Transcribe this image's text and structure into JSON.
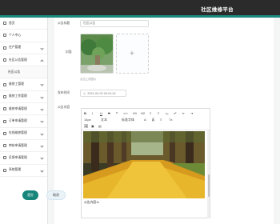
{
  "app": {
    "title": "社区维修平台"
  },
  "sidebar": {
    "items": [
      {
        "label": "首页",
        "icon": "home-icon"
      },
      {
        "label": "个人中心",
        "icon": "user-icon"
      },
      {
        "label": "住户管理",
        "icon": "users-icon"
      },
      {
        "label": "社区公告管理",
        "icon": "notice-icon"
      },
      {
        "label": "社区公告",
        "icon": ""
      },
      {
        "label": "维修工管理",
        "icon": "worker-icon"
      },
      {
        "label": "维修工作管理",
        "icon": "work-icon"
      },
      {
        "label": "维修申请管理",
        "icon": "apply-icon"
      },
      {
        "label": "订单申请管理",
        "icon": "order-icon"
      },
      {
        "label": "在线维修管理",
        "icon": "repair-icon"
      },
      {
        "label": "审核申请管理",
        "icon": "audit-icon"
      },
      {
        "label": "反馈申请管理",
        "icon": "feedback-icon"
      },
      {
        "label": "系统管理",
        "icon": "system-icon"
      }
    ]
  },
  "form": {
    "title_label": "公告标题",
    "title_value": "社区公告",
    "cover_label": "封面",
    "cover_hint": "点击上传图片",
    "time_label": "发布时间",
    "time_value": "2021-02-02 00:01:42",
    "content_label": "公告内容",
    "content_text": "公告内容11",
    "toolbar": {
      "row1": [
        "B",
        "I",
        "U",
        "S",
        "❝",
        "</>",
        "H1",
        "H2",
        "≡",
        "≡",
        "x₂",
        "x²",
        "⇤",
        "⇥"
      ],
      "row2": [
        "14px",
        "文本",
        "标准字体",
        "A",
        "A",
        "≡",
        "Tx"
      ],
      "row3": [
        "🖼",
        "▣",
        "▤"
      ]
    },
    "submit_label": "提交",
    "cancel_label": "取消"
  },
  "colors": {
    "accent": "#18857a",
    "topbar": "#2b2b2b"
  }
}
